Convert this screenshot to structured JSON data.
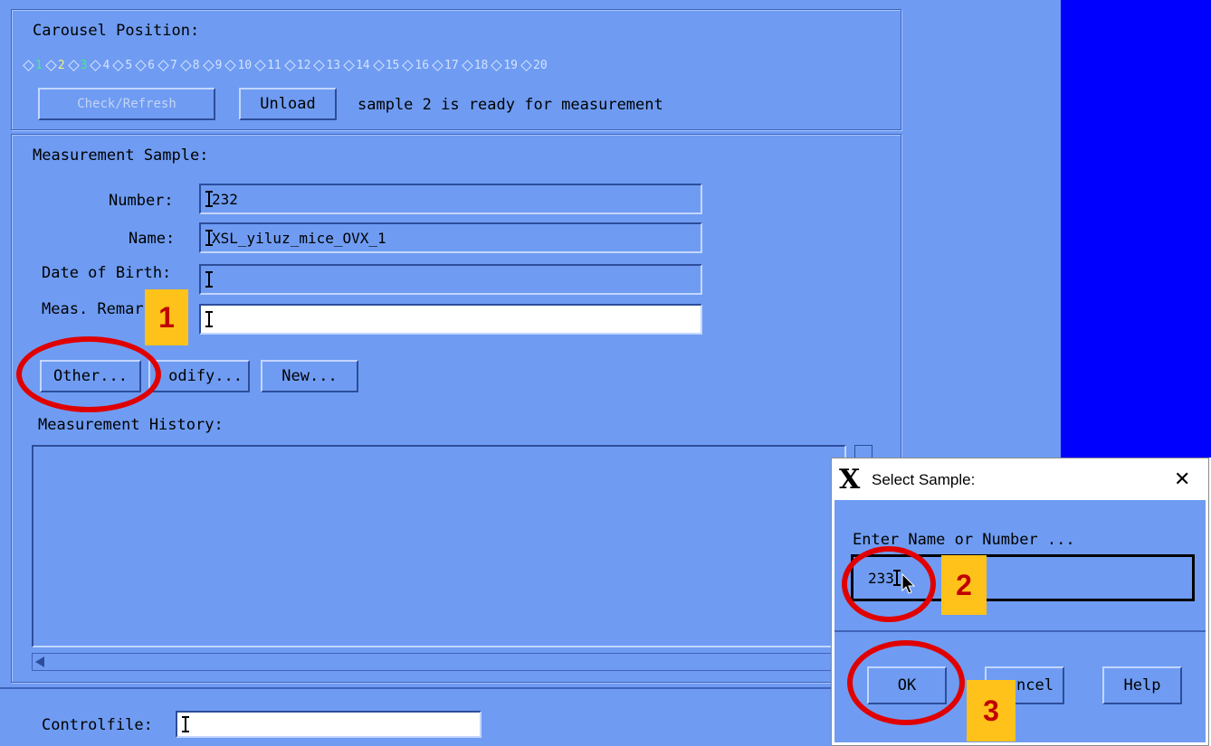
{
  "carousel": {
    "title": "Carousel Position:",
    "positions": [
      "1",
      "2",
      "3",
      "4",
      "5",
      "6",
      "7",
      "8",
      "9",
      "10",
      "11",
      "12",
      "13",
      "14",
      "15",
      "16",
      "17",
      "18",
      "19",
      "20"
    ],
    "check_refresh_label": "Check/Refresh",
    "unload_label": "Unload",
    "status": "sample 2 is ready for measurement"
  },
  "sample": {
    "title": "Measurement Sample:",
    "number_label": "Number:",
    "number_value": "232",
    "name_label": "Name:",
    "name_value": "XSL_yiluz_mice_OVX_1",
    "dob_label": "Date of Birth:",
    "dob_value": "",
    "remark_label": "Meas. Remar",
    "remark_value": "",
    "other_label": "Other...",
    "modify_label": "odify...",
    "new_label": "New..."
  },
  "history": {
    "title": "Measurement History:"
  },
  "controlfile": {
    "label": "Controlfile:",
    "value": ""
  },
  "dialog": {
    "title": "Select Sample:",
    "prompt": "Enter Name or Number ...",
    "input_value": "233",
    "ok_label": "OK",
    "cancel_label": "ncel",
    "help_label": "Help",
    "close_glyph": "✕",
    "x_logo": "X"
  },
  "annotations": {
    "step1": "1",
    "step2": "2",
    "step3": "3"
  },
  "colors": {
    "panel": "#6f9cf2",
    "right_panel": "#0000ff",
    "accent_red": "#e00000",
    "badge": "#ffc21a"
  }
}
